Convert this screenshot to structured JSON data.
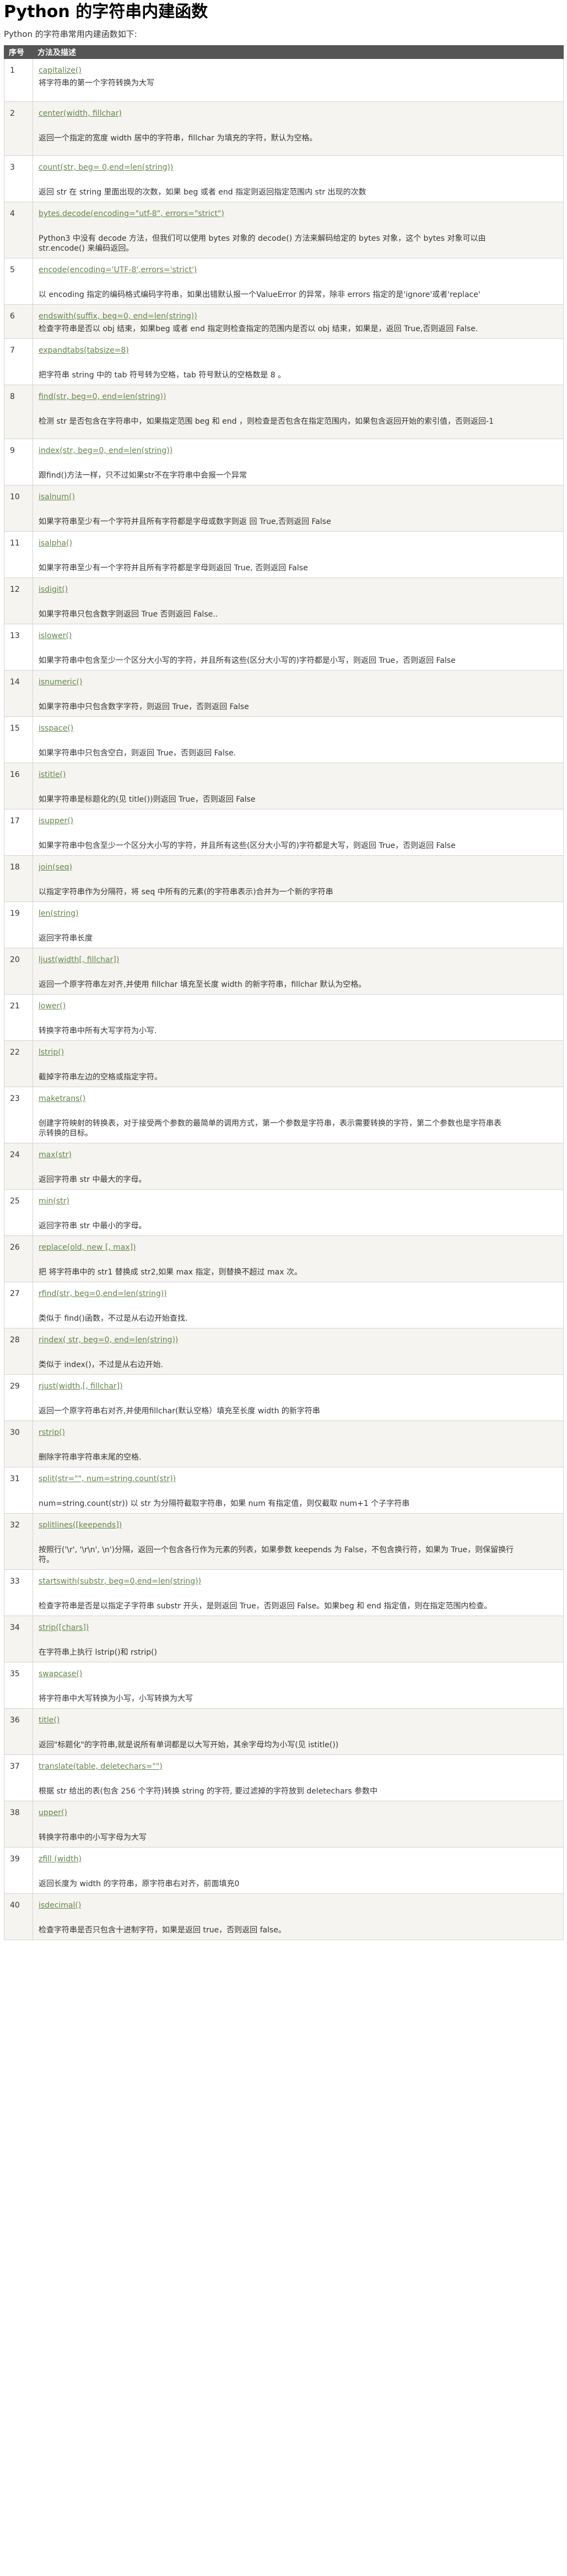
{
  "title": "Python 的字符串内建函数",
  "intro": "Python 的字符串常用内建函数如下:",
  "table": {
    "headers": [
      "序号",
      "方法及描述"
    ],
    "rows": [
      {
        "no": "1",
        "method": "capitalize()",
        "desc": [
          "将字符串的第一个字符转换为大写"
        ]
      },
      {
        "no": "2",
        "method": "center(width, fillchar)",
        "desc": [
          "返回一个指定的宽度 width 居中的字符串，fillchar 为填充的字符，默认为空格。"
        ]
      },
      {
        "no": "3",
        "method": "count(str, beg= 0,end=len(string))",
        "desc": [
          "返回 str 在 string 里面出现的次数，如果 beg 或者 end 指定则返回指定范围内 str 出现的次数"
        ]
      },
      {
        "no": "4",
        "method": "bytes.decode(encoding=\"utf-8\", errors=\"strict\")",
        "desc": [
          "Python3 中没有 decode 方法，但我们可以使用 bytes 对象的 decode() 方法来解码给定的 bytes 对象，这个 bytes 对象可以由",
          "str.encode() 来编码返回。"
        ]
      },
      {
        "no": "5",
        "method": "encode(encoding='UTF-8',errors='strict')",
        "desc": [
          "以 encoding 指定的编码格式编码字符串，如果出错默认报一个ValueError 的异常，除非 errors 指定的是'ignore'或者'replace'"
        ]
      },
      {
        "no": "6",
        "method": "endswith(suffix, beg=0, end=len(string))",
        "desc": [
          "检查字符串是否以 obj 结束，如果beg 或者 end 指定则检查指定的范围内是否以 obj 结束，如果是，返回 True,否则返回 False."
        ]
      },
      {
        "no": "7",
        "method": "expandtabs(tabsize=8)",
        "desc": [
          "把字符串 string 中的 tab 符号转为空格，tab 符号默认的空格数是 8 。"
        ]
      },
      {
        "no": "8",
        "method": "find(str, beg=0, end=len(string))",
        "desc": [
          "检测 str 是否包含在字符串中，如果指定范围 beg 和 end ，则检查是否包含在指定范围内，如果包含返回开始的索引值，否则返回-1"
        ]
      },
      {
        "no": "9",
        "method": "index(str, beg=0, end=len(string))",
        "desc": [
          "跟find()方法一样，只不过如果str不在字符串中会报一个异常"
        ]
      },
      {
        "no": "10",
        "method": "isalnum()",
        "desc": [
          "如果字符串至少有一个字符并且所有字符都是字母或数字则返 回 True,否则返回 False"
        ]
      },
      {
        "no": "11",
        "method": "isalpha()",
        "desc": [
          "如果字符串至少有一个字符并且所有字符都是字母则返回 True, 否则返回 False"
        ]
      },
      {
        "no": "12",
        "method": "isdigit()",
        "desc": [
          "如果字符串只包含数字则返回 True 否则返回 False.."
        ]
      },
      {
        "no": "13",
        "method": "islower()",
        "desc": [
          "如果字符串中包含至少一个区分大小写的字符，并且所有这些(区分大小写的)字符都是小写，则返回 True，否则返回 False"
        ]
      },
      {
        "no": "14",
        "method": "isnumeric()",
        "desc": [
          "如果字符串中只包含数字字符，则返回 True，否则返回 False"
        ]
      },
      {
        "no": "15",
        "method": "isspace()",
        "desc": [
          "如果字符串中只包含空白，则返回 True，否则返回 False."
        ]
      },
      {
        "no": "16",
        "method": "istitle()",
        "desc": [
          "如果字符串是标题化的(见 title())则返回 True，否则返回 False"
        ]
      },
      {
        "no": "17",
        "method": "isupper()",
        "desc": [
          "如果字符串中包含至少一个区分大小写的字符，并且所有这些(区分大小写的)字符都是大写，则返回 True，否则返回 False"
        ]
      },
      {
        "no": "18",
        "method": "join(seq)",
        "desc": [
          "以指定字符串作为分隔符，将 seq 中所有的元素(的字符串表示)合并为一个新的字符串"
        ]
      },
      {
        "no": "19",
        "method": "len(string)",
        "desc": [
          "返回字符串长度"
        ]
      },
      {
        "no": "20",
        "method": "ljust(width[, fillchar])",
        "desc": [
          "返回一个原字符串左对齐,并使用 fillchar 填充至长度 width 的新字符串，fillchar 默认为空格。"
        ]
      },
      {
        "no": "21",
        "method": "lower()",
        "desc": [
          "转换字符串中所有大写字符为小写."
        ]
      },
      {
        "no": "22",
        "method": "lstrip()",
        "desc": [
          "截掉字符串左边的空格或指定字符。"
        ]
      },
      {
        "no": "23",
        "method": "maketrans()",
        "desc": [
          "创建字符映射的转换表，对于接受两个参数的最简单的调用方式，第一个参数是字符串，表示需要转换的字符，第二个参数也是字符串表",
          "示转换的目标。"
        ]
      },
      {
        "no": "24",
        "method": "max(str)",
        "desc": [
          "返回字符串 str 中最大的字母。"
        ]
      },
      {
        "no": "25",
        "method": "min(str)",
        "desc": [
          "返回字符串 str 中最小的字母。"
        ]
      },
      {
        "no": "26",
        "method": "replace(old, new [, max])",
        "desc": [
          "把 将字符串中的 str1 替换成 str2,如果 max 指定，则替换不超过 max 次。"
        ]
      },
      {
        "no": "27",
        "method": "rfind(str, beg=0,end=len(string))",
        "desc": [
          "类似于 find()函数，不过是从右边开始查找."
        ]
      },
      {
        "no": "28",
        "method": "rindex( str, beg=0, end=len(string))",
        "desc": [
          "类似于 index()，不过是从右边开始."
        ]
      },
      {
        "no": "29",
        "method": "rjust(width,[, fillchar])",
        "desc": [
          "返回一个原字符串右对齐,并使用fillchar(默认空格）填充至长度 width 的新字符串"
        ]
      },
      {
        "no": "30",
        "method": "rstrip()",
        "desc": [
          "删除字符串字符串末尾的空格."
        ]
      },
      {
        "no": "31",
        "method": "split(str=\"\", num=string.count(str))",
        "desc": [
          "num=string.count(str)) 以 str 为分隔符截取字符串，如果 num 有指定值，则仅截取 num+1 个子字符串"
        ]
      },
      {
        "no": "32",
        "method": "splitlines([keepends])",
        "desc": [
          "按照行('\\r', '\\r\\n', \\n')分隔，返回一个包含各行作为元素的列表，如果参数 keepends 为 False，不包含换行符，如果为 True，则保留换行",
          "符。"
        ]
      },
      {
        "no": "33",
        "method": "startswith(substr, beg=0,end=len(string))",
        "desc": [
          "检查字符串是否是以指定子字符串 substr 开头，是则返回 True，否则返回 False。如果beg 和 end 指定值，则在指定范围内检查。"
        ]
      },
      {
        "no": "34",
        "method": "strip([chars])",
        "desc": [
          "在字符串上执行 lstrip()和 rstrip()"
        ]
      },
      {
        "no": "35",
        "method": "swapcase()",
        "desc": [
          "将字符串中大写转换为小写，小写转换为大写"
        ]
      },
      {
        "no": "36",
        "method": "title()",
        "desc": [
          "返回\"标题化\"的字符串,就是说所有单词都是以大写开始，其余字母均为小写(见 istitle())"
        ]
      },
      {
        "no": "37",
        "method": "translate(table, deletechars=\"\")",
        "desc": [
          "根据 str 给出的表(包含 256 个字符)转换 string 的字符, 要过滤掉的字符放到 deletechars 参数中"
        ]
      },
      {
        "no": "38",
        "method": "upper()",
        "desc": [
          "转换字符串中的小写字母为大写"
        ]
      },
      {
        "no": "39",
        "method": "zfill (width)",
        "desc": [
          "返回长度为 width 的字符串，原字符串右对齐，前面填充0"
        ]
      },
      {
        "no": "40",
        "method": "isdecimal()",
        "desc": [
          "检查字符串是否只包含十进制字符，如果是返回 true，否则返回 false。"
        ]
      }
    ]
  },
  "colors": {
    "header_bg": "#555555",
    "link": "#64854c",
    "row_alt_bg": "#f6f4f0",
    "border": "#d4d4d4"
  }
}
